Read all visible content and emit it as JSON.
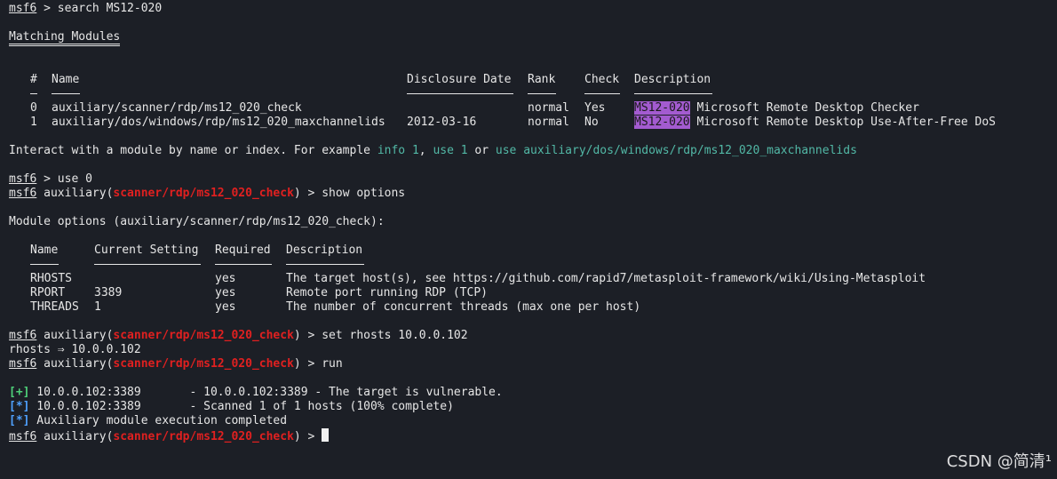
{
  "prompt": "msf6",
  "cmd_search": " > search MS12-020",
  "heading_matching": "Matching Modules",
  "table1": {
    "headers": [
      "#",
      "Name",
      "Disclosure Date",
      "Rank",
      "Check",
      "Description"
    ],
    "rows": [
      {
        "idx": "0",
        "name": "auxiliary/scanner/rdp/ms12_020_check",
        "date": "",
        "rank": "normal",
        "check": "Yes",
        "hl": "MS12-020",
        "desc": " Microsoft Remote Desktop Checker"
      },
      {
        "idx": "1",
        "name": "auxiliary/dos/windows/rdp/ms12_020_maxchannelids",
        "date": "2012-03-16",
        "rank": "normal",
        "check": "No",
        "hl": "MS12-020",
        "desc": " Microsoft Remote Desktop Use-After-Free DoS"
      }
    ]
  },
  "interact": {
    "pre": "Interact with a module by name or index. For example ",
    "l1": "info 1",
    "sep1": ", ",
    "l2": "use 1",
    "sep2": " or ",
    "l3": "use auxiliary/dos/windows/rdp/ms12_020_maxchannelids"
  },
  "cmd_use": " > use 0",
  "aux_prefix": " auxiliary(",
  "module_name": "scanner/rdp/ms12_020_check",
  "aux_suffix": ")",
  "cmd_show": " > show options",
  "module_options": "Module options (auxiliary/scanner/rdp/ms12_020_check):",
  "table2": {
    "headers": [
      "Name",
      "Current Setting",
      "Required",
      "Description"
    ],
    "rows": [
      {
        "name": "RHOSTS",
        "setting": "",
        "required": "yes",
        "desc": "The target host(s), see https://github.com/rapid7/metasploit-framework/wiki/Using-Metasploit"
      },
      {
        "name": "RPORT",
        "setting": "3389",
        "required": "yes",
        "desc": "Remote port running RDP (TCP)"
      },
      {
        "name": "THREADS",
        "setting": "1",
        "required": "yes",
        "desc": "The number of concurrent threads (max one per host)"
      }
    ]
  },
  "cmd_set": " > set rhosts 10.0.0.102",
  "set_result": "rhosts ⇒ 10.0.0.102",
  "cmd_run": " > run",
  "results": [
    {
      "tag": "[+]",
      "text": " 10.0.0.102:3389       - 10.0.0.102:3389 - The target is vulnerable."
    },
    {
      "tag": "[*]",
      "text": " 10.0.0.102:3389       - Scanned 1 of 1 hosts (100% complete)"
    },
    {
      "tag": "[*]",
      "text": " Auxiliary module execution completed"
    }
  ],
  "cmd_final": " > ",
  "watermark": "CSDN @简清¹",
  "colors": {
    "background": "#1c1f26",
    "module_red": "#e02020",
    "highlight_purple": "#a35bd0",
    "link_teal": "#52b8a6",
    "info_blue": "#4fa1ff",
    "success_green": "#4fd27a"
  }
}
